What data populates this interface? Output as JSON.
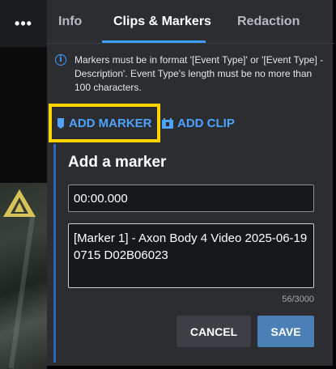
{
  "menu": {
    "more_label": "•••"
  },
  "tabs": [
    {
      "label": "Info",
      "active": false
    },
    {
      "label": "Clips & Markers",
      "active": true
    },
    {
      "label": "Redaction",
      "active": false
    }
  ],
  "info": {
    "icon": "info-circle-icon",
    "text": "Markers must be in format '[Event Type]' or '[Event Type] - Description'. Event Type's length must be no more than 100 characters."
  },
  "actions": {
    "add_marker_label": "ADD MARKER",
    "add_marker_icon": "marker-tag-icon",
    "add_clip_label": "ADD CLIP",
    "add_clip_icon": "clip-icon"
  },
  "form": {
    "title": "Add a marker",
    "time_value": "00:00.000",
    "description_value": "[Marker 1] - Axon Body 4 Video 2025-06-19 0715 D02B06023",
    "char_count": "56/3000",
    "cancel_label": "CANCEL",
    "save_label": "SAVE"
  },
  "colors": {
    "accent": "#3f9dff",
    "highlight": "#ffd400",
    "panel_bg": "#2b2d31",
    "save_bg": "#4d7fb7"
  }
}
